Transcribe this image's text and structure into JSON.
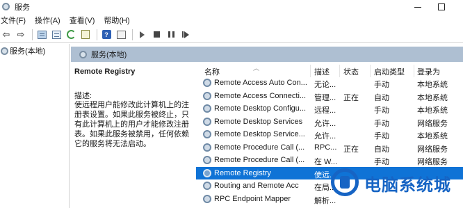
{
  "window": {
    "title": "服务"
  },
  "menu": [
    "文件(F)",
    "操作(A)",
    "查看(V)",
    "帮助(H)"
  ],
  "tree": {
    "root_label": "服务(本地)"
  },
  "pane": {
    "title": "服务(本地)"
  },
  "detail": {
    "service_name": "Remote Registry",
    "desc_label": "描述:",
    "desc_text": "使远程用户能修改此计算机上的注册表设置。如果此服务被终止，只有此计算机上的用户才能修改注册表。如果此服务被禁用，任何依赖它的服务将无法启动。"
  },
  "columns": {
    "name": "名称",
    "desc": "描述",
    "status": "状态",
    "start": "启动类型",
    "logon": "登录为"
  },
  "services": [
    {
      "name": "Remote Access Auto Con...",
      "desc": "无论...",
      "status": "",
      "start": "手动",
      "logon": "本地系统"
    },
    {
      "name": "Remote Access Connecti...",
      "desc": "管理...",
      "status": "正在",
      "start": "自动",
      "logon": "本地系统"
    },
    {
      "name": "Remote Desktop Configu...",
      "desc": "远程...",
      "status": "",
      "start": "手动",
      "logon": "本地系统"
    },
    {
      "name": "Remote Desktop Services",
      "desc": "允许...",
      "status": "",
      "start": "手动",
      "logon": "网络服务"
    },
    {
      "name": "Remote Desktop Service...",
      "desc": "允许...",
      "status": "",
      "start": "手动",
      "logon": "本地系统"
    },
    {
      "name": "Remote Procedure Call (...",
      "desc": "RPC...",
      "status": "正在",
      "start": "自动",
      "logon": "网络服务"
    },
    {
      "name": "Remote Procedure Call (...",
      "desc": "在 W...",
      "status": "",
      "start": "手动",
      "logon": "网络服务"
    },
    {
      "name": "Remote Registry",
      "desc": "使远...",
      "status": "",
      "start": "",
      "logon": ""
    },
    {
      "name": "Routing and Remote Acc",
      "desc": "在局...",
      "status": "",
      "start": "",
      "logon": ""
    },
    {
      "name": "RPC Endpoint Mapper",
      "desc": "解析...",
      "status": "",
      "start": "",
      "logon": ""
    }
  ],
  "selected_index": 7,
  "colors": {
    "pane_header": "#aebfd2",
    "selection": "#0f73d6",
    "watermark": "#1664c4"
  },
  "watermark": {
    "text": "电脑系统城"
  },
  "icons": [
    "back-arrow-icon",
    "forward-arrow-icon",
    "console-tree-icon",
    "show-hide-icon",
    "refresh-icon",
    "export-list-icon",
    "help-icon",
    "properties-icon",
    "start-service-icon",
    "stop-service-icon",
    "pause-service-icon",
    "restart-service-icon",
    "service-gear-icon"
  ]
}
